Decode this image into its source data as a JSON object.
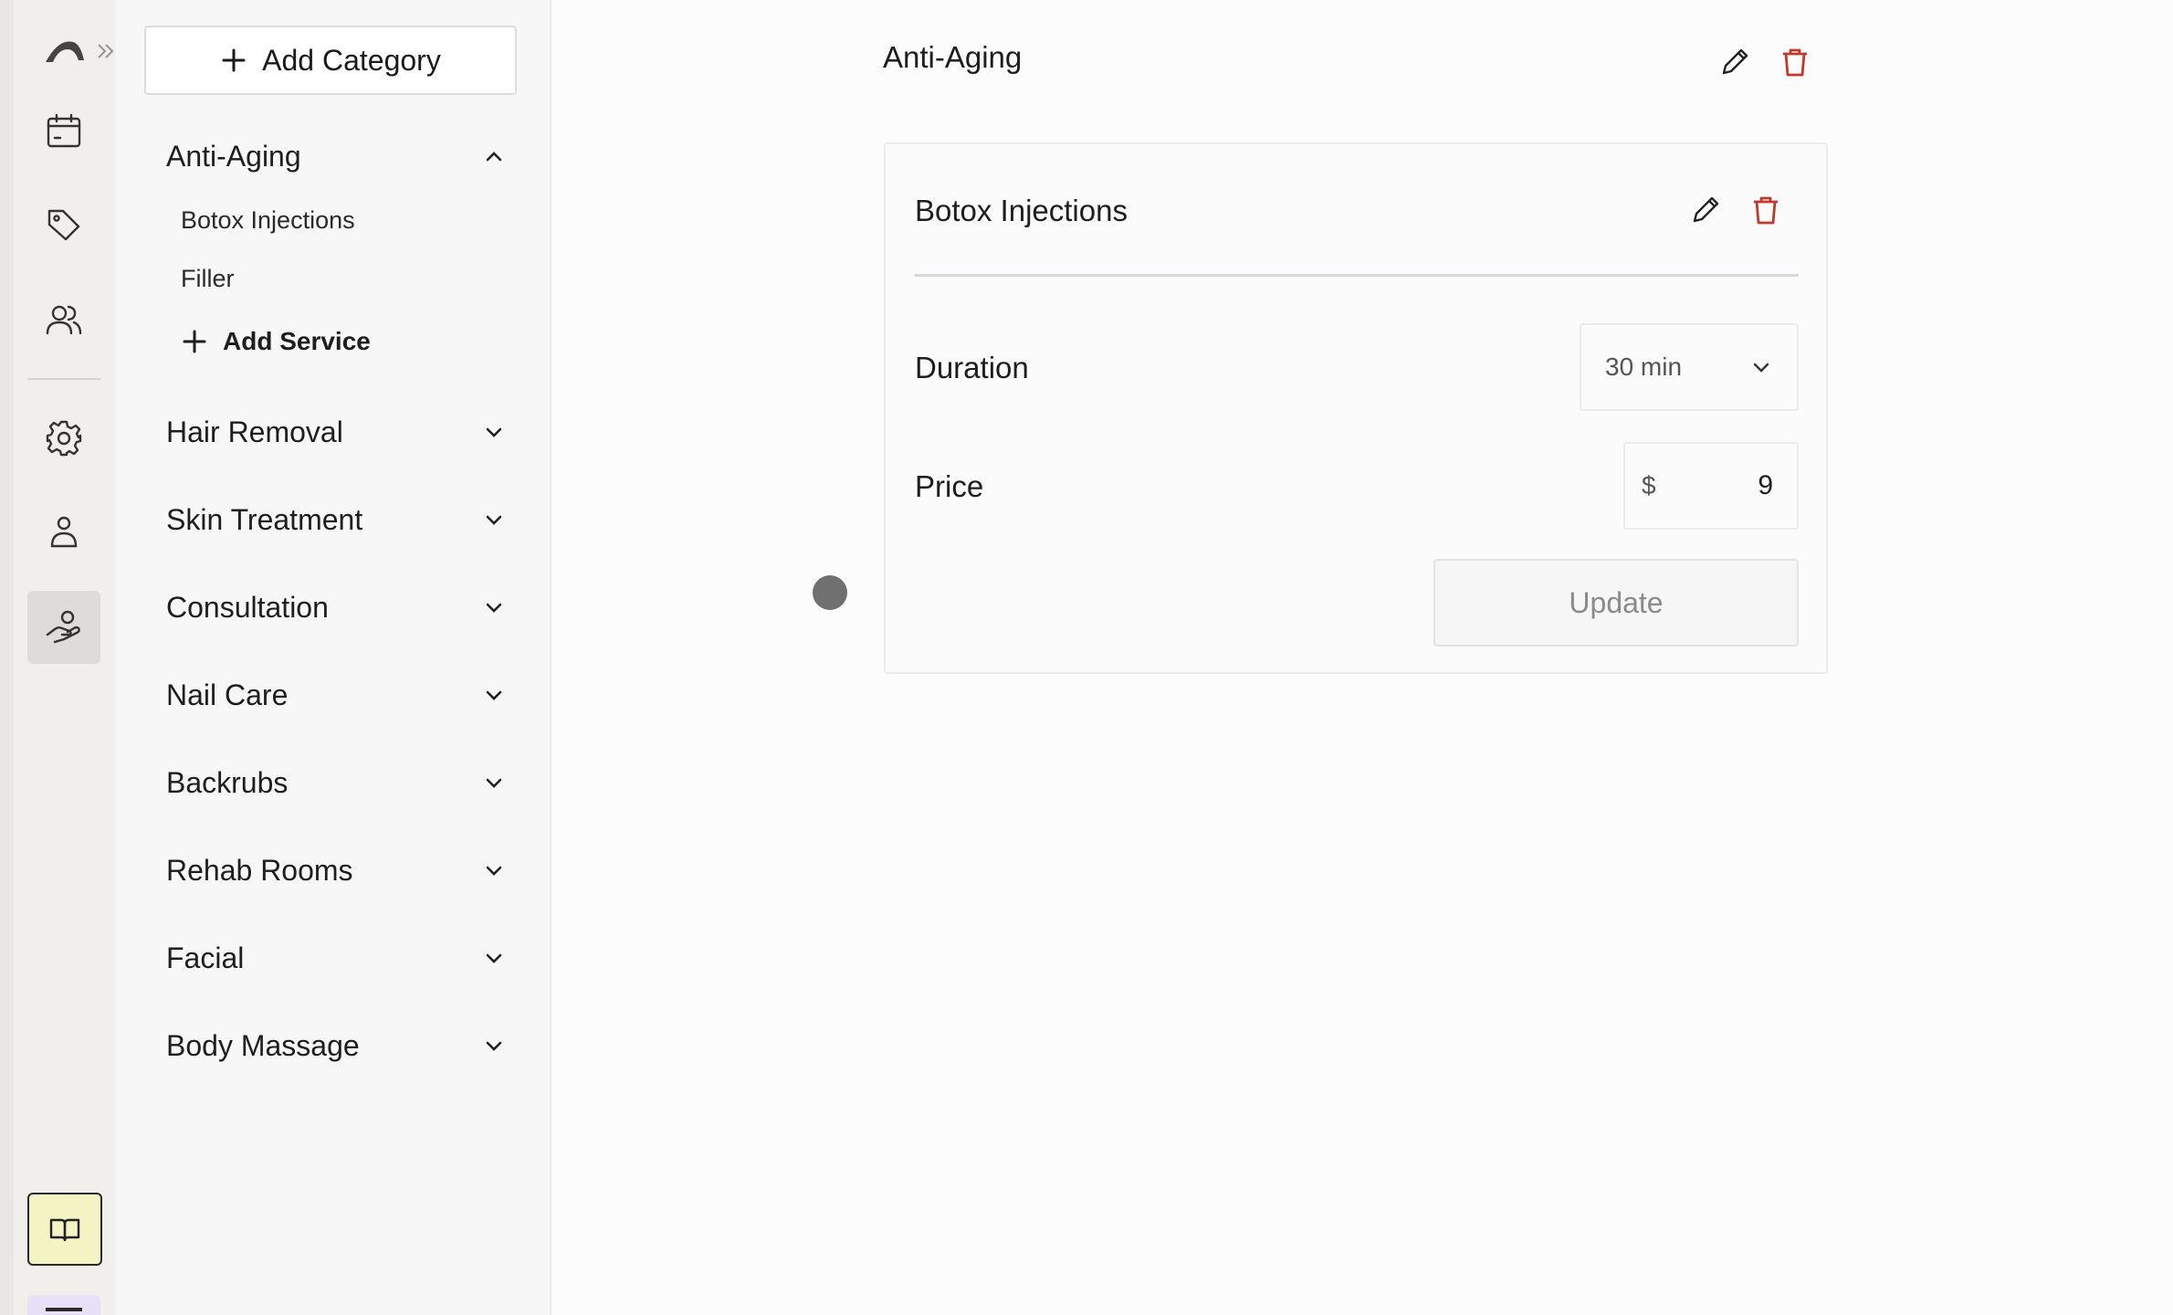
{
  "rail": {
    "icons": [
      "logo-icon",
      "expand-icon",
      "calendar-icon",
      "tag-icon",
      "users-icon",
      "gear-icon",
      "user-icon",
      "hand-heart-icon",
      "book-icon"
    ],
    "active": "hand-heart-icon"
  },
  "categories_panel": {
    "add_category_label": "Add Category",
    "categories": [
      {
        "name": "Anti-Aging",
        "expanded": true,
        "services": [
          "Botox Injections",
          "Filler"
        ],
        "add_service_label": "Add Service"
      },
      {
        "name": "Hair Removal",
        "expanded": false
      },
      {
        "name": "Skin Treatment",
        "expanded": false
      },
      {
        "name": "Consultation",
        "expanded": false
      },
      {
        "name": "Nail Care",
        "expanded": false
      },
      {
        "name": "Backrubs",
        "expanded": false
      },
      {
        "name": "Rehab Rooms",
        "expanded": false
      },
      {
        "name": "Facial",
        "expanded": false
      },
      {
        "name": "Body Massage",
        "expanded": false
      }
    ]
  },
  "main": {
    "category_title": "Anti-Aging",
    "service": {
      "name": "Botox Injections",
      "duration_label": "Duration",
      "duration_value": "30 min",
      "price_label": "Price",
      "currency": "$",
      "price_value": "9",
      "update_label": "Update"
    }
  },
  "colors": {
    "danger": "#c0392b",
    "rail_bg": "#f1efec",
    "active_rail": "#dedcd8",
    "book_button": "#f3f3c4"
  }
}
